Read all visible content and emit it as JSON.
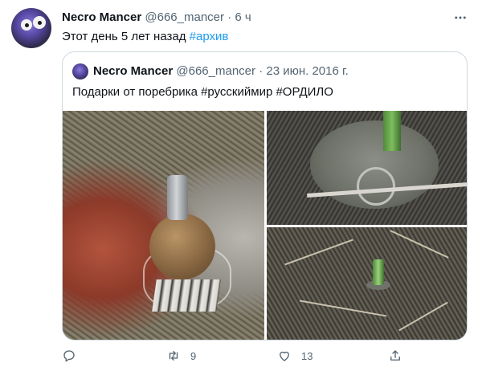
{
  "tweet": {
    "author_name": "Necro Mancer",
    "handle": "@666_mancer",
    "separator": "·",
    "time": "6 ч",
    "text": "Этот день 5 лет назад ",
    "hashtag": "#архив",
    "more_icon": "more-dots-icon"
  },
  "quote": {
    "author_name": "Necro Mancer",
    "handle": "@666_mancer",
    "separator": "·",
    "time": "23 июн. 2016 г.",
    "text": "Подарки от поребрика #русскиймир #ОРДИЛО"
  },
  "actions": {
    "reply": {
      "icon": "reply-icon",
      "count": ""
    },
    "retweet": {
      "icon": "retweet-icon",
      "count": "9"
    },
    "like": {
      "icon": "heart-icon",
      "count": "13"
    },
    "share": {
      "icon": "share-icon",
      "count": ""
    }
  },
  "colors": {
    "accent": "#1d9bf0",
    "secondary_text": "#536471",
    "border": "#cfd9de"
  }
}
